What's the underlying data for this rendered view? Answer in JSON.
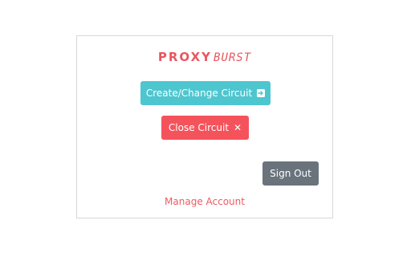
{
  "brand": {
    "proxy": "PROXY",
    "burst": "BURST",
    "accent_color": "#e8575f"
  },
  "actions": {
    "create_label": "Create/Change Circuit",
    "create_icon": "enter-icon",
    "create_color": "#4ec6cf",
    "close_label": "Close Circuit",
    "close_icon": "close-icon",
    "close_color": "#f5535c",
    "signout_label": "Sign Out",
    "signout_color": "#6a737c"
  },
  "footer": {
    "manage_label": "Manage Account"
  }
}
